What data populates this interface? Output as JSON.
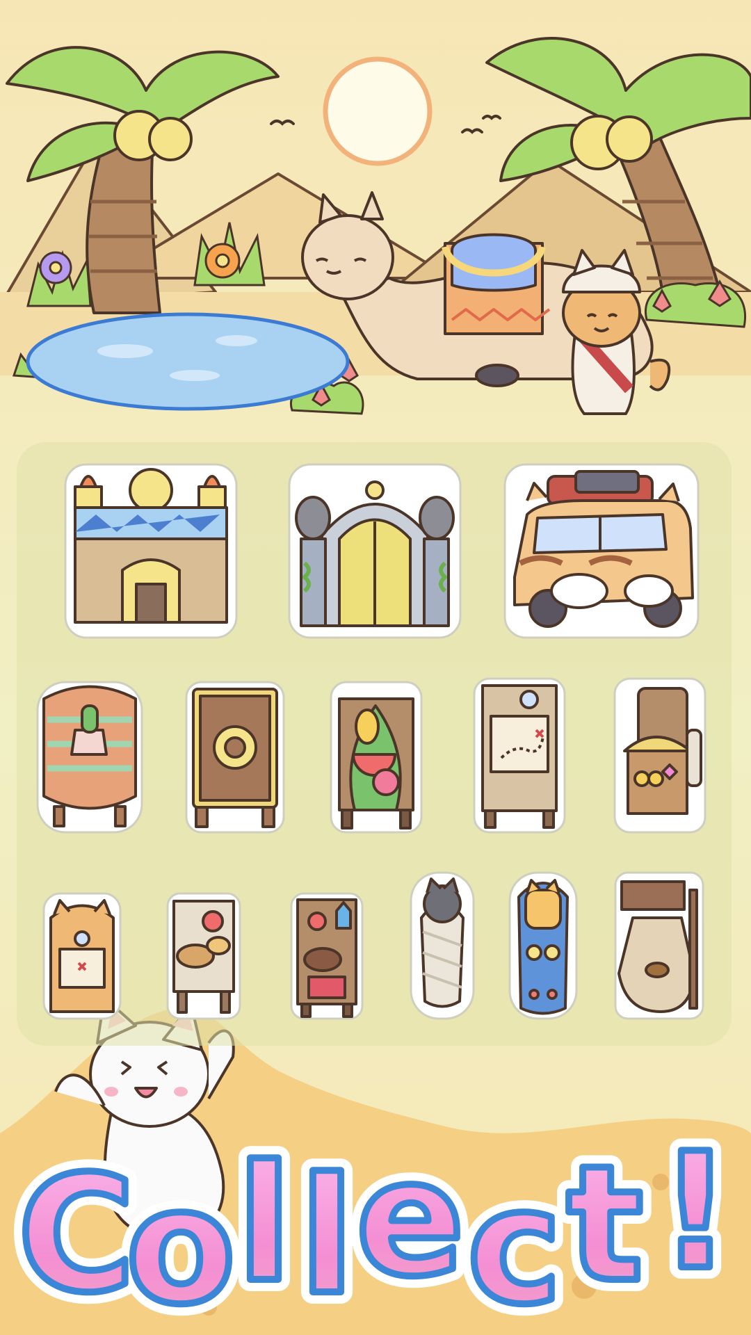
{
  "banner": {
    "text": "Collect!",
    "letters": [
      "C",
      "o",
      "l",
      "l",
      "e",
      "c",
      "t",
      "!"
    ]
  },
  "colors": {
    "sky": "#f7e8b6",
    "sand": "#f2d79c",
    "oasis_water": "#a9d2f2",
    "palm_leaf": "#a7d86b",
    "panel": "#e3e4aa",
    "banner_fill": "#f49bd7",
    "banner_outline": "#3b86d6"
  },
  "scene": {
    "elements": [
      "palm-tree-left",
      "palm-tree-right",
      "sun",
      "pyramids",
      "oasis-pond",
      "camel",
      "explorer-cat",
      "desert-flowers",
      "birds"
    ]
  },
  "collection": {
    "rows": [
      [
        "temple-altar",
        "golden-gate",
        "cat-safari-van"
      ],
      [
        "cactus-barrel",
        "sun-emblem-cabinet",
        "fruit-stand",
        "map-desk",
        "treasure-chest"
      ],
      [
        "cat-map-stand",
        "food-table",
        "pantry-shelf",
        "gray-cat-mummy",
        "blue-cat-sarcophagus",
        "coffee-sack"
      ]
    ]
  }
}
